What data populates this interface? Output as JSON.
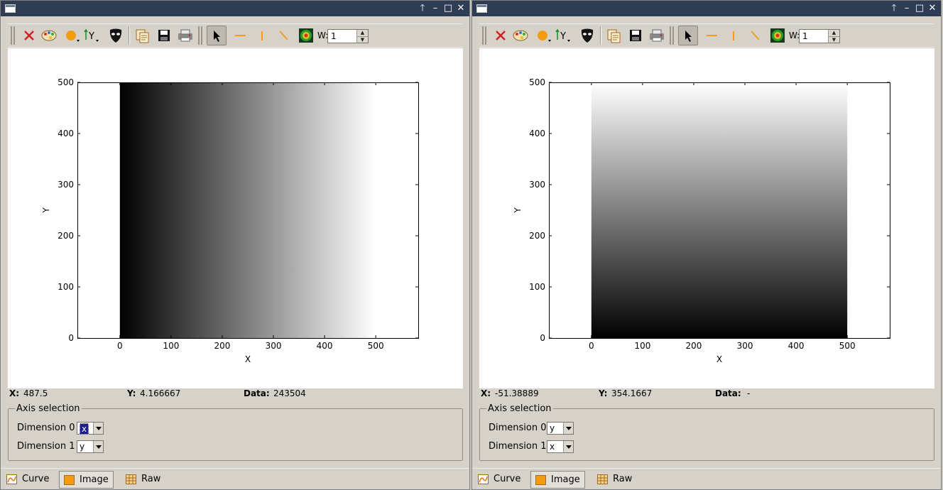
{
  "panels": [
    {
      "id": "left",
      "toolbar": {
        "width_label": "W:",
        "width_value": "1"
      },
      "status": {
        "x_label": "X:",
        "x_value": "487.5",
        "y_label": "Y:",
        "y_value": "4.166667",
        "data_label": "Data:",
        "data_value": "243504"
      },
      "axis_selection": {
        "title": "Axis selection",
        "dim0_label": "Dimension 0",
        "dim0_value": "x",
        "dim1_label": "Dimension 1",
        "dim1_value": "y"
      },
      "tabs": [
        {
          "label": "Curve"
        },
        {
          "label": "Image",
          "active": true
        },
        {
          "label": "Raw"
        }
      ]
    },
    {
      "id": "right",
      "toolbar": {
        "width_label": "W:",
        "width_value": "1"
      },
      "status": {
        "x_label": "X:",
        "x_value": "-51.38889",
        "y_label": "Y:",
        "y_value": "354.1667",
        "data_label": "Data:",
        "data_value": "-"
      },
      "axis_selection": {
        "title": "Axis selection",
        "dim0_label": "Dimension 0",
        "dim0_value": "y",
        "dim1_label": "Dimension 1",
        "dim1_value": "x"
      },
      "tabs": [
        {
          "label": "Curve"
        },
        {
          "label": "Image",
          "active": true
        },
        {
          "label": "Raw"
        }
      ]
    }
  ],
  "chart_data": [
    {
      "type": "heatmap",
      "xlabel": "X",
      "ylabel": "Y",
      "xlim": [
        -83,
        583
      ],
      "ylim": [
        0,
        500
      ],
      "xticks": [
        0,
        100,
        200,
        300,
        400,
        500
      ],
      "yticks": [
        0,
        100,
        200,
        300,
        400,
        500
      ],
      "image_extent": {
        "x": [
          0,
          500
        ],
        "y": [
          0,
          500
        ]
      },
      "gradient_direction": "x",
      "colormap": "grayscale",
      "gradient_colors": [
        "#000000",
        "#ffffff"
      ]
    },
    {
      "type": "heatmap",
      "xlabel": "X",
      "ylabel": "Y",
      "xlim": [
        -83,
        583
      ],
      "ylim": [
        0,
        500
      ],
      "xticks": [
        0,
        100,
        200,
        300,
        400,
        500
      ],
      "yticks": [
        0,
        100,
        200,
        300,
        400,
        500
      ],
      "image_extent": {
        "x": [
          0,
          500
        ],
        "y": [
          0,
          500
        ]
      },
      "gradient_direction": "y",
      "colormap": "grayscale",
      "gradient_colors": [
        "#000000",
        "#ffffff"
      ]
    }
  ],
  "colors": {
    "titlebar": "#2f3d54",
    "window_bg": "#d6d2ca",
    "accent_orange": "#f39c12",
    "selection": "#1a1a8c"
  }
}
